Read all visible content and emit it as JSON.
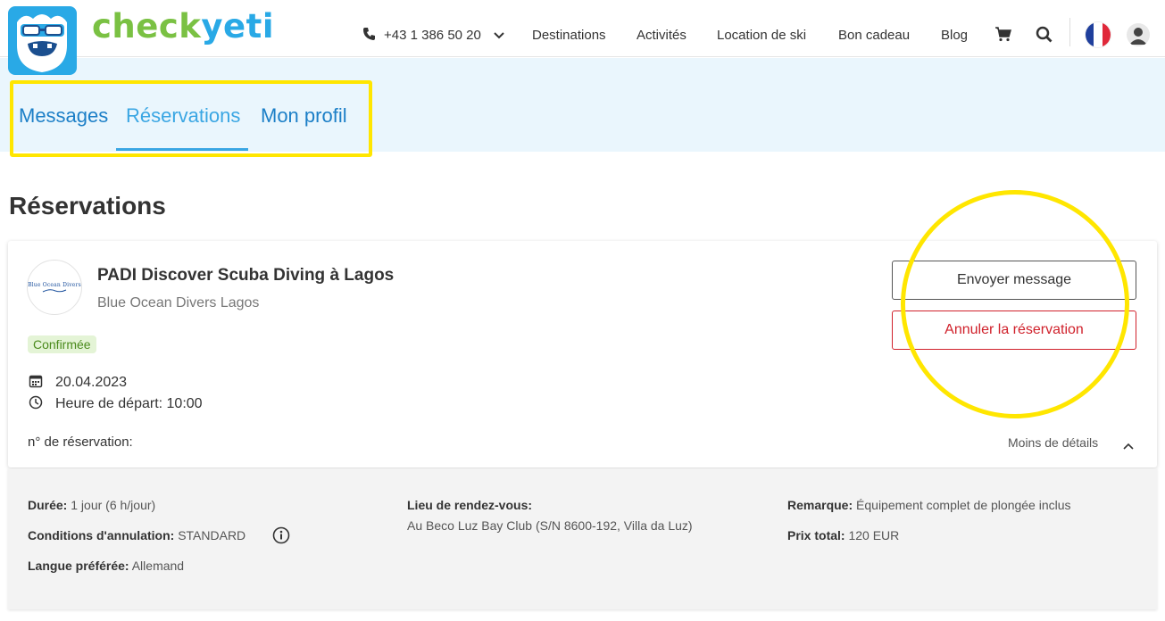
{
  "brand": {
    "part1": "check",
    "part2": "yeti"
  },
  "header": {
    "phone": "+43 1 386 50 20",
    "nav": [
      "Destinations",
      "Activités",
      "Location de ski",
      "Bon cadeau",
      "Blog"
    ]
  },
  "tabs": [
    {
      "label": "Messages",
      "active": false
    },
    {
      "label": "Réservations",
      "active": true
    },
    {
      "label": "Mon profil",
      "active": false
    }
  ],
  "page_title": "Réservations",
  "booking": {
    "provider_logo_text": "Blue Ocean Divers",
    "title": "PADI Discover Scuba Diving à Lagos",
    "provider": "Blue Ocean Divers Lagos",
    "status": "Confirmée",
    "date": "20.04.2023",
    "departure": "Heure de départ: 10:00",
    "reservation_number_label": "n° de réservation:",
    "less_details": "Moins de détails",
    "send_message": "Envoyer message",
    "cancel": "Annuler la réservation"
  },
  "details": {
    "duration_label": "Durée:",
    "duration_value": "1 jour (6 h/jour)",
    "cancellation_label": "Conditions d'annulation:",
    "cancellation_value": "STANDARD",
    "language_label": "Langue préférée:",
    "language_value": "Allemand",
    "meeting_label": "Lieu de rendez-vous:",
    "meeting_value": "Au Beco Luz Bay Club (S/N 8600-192, Villa da Luz)",
    "remark_label": "Remarque:",
    "remark_value": "Équipement complet de plongée inclus",
    "price_label": "Prix total:",
    "price_value": "120 EUR"
  },
  "colors": {
    "brand_green": "#7ac143",
    "brand_blue": "#29a9e6",
    "highlight": "#ffe600",
    "cancel_red": "#d0212b"
  }
}
